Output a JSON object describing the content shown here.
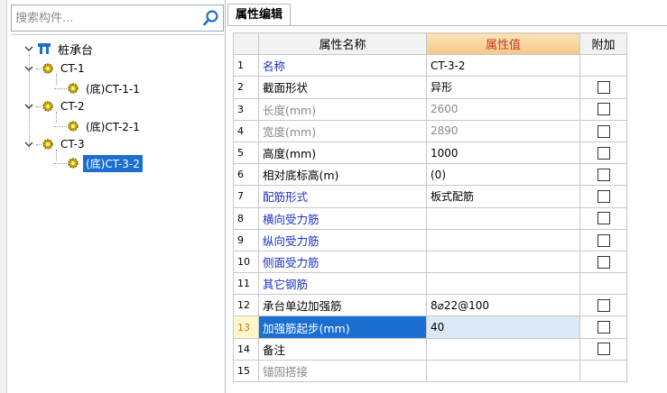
{
  "search": {
    "placeholder": "搜索构件..."
  },
  "tree": {
    "root": "桩承台",
    "groups": [
      {
        "label": "CT-1",
        "child": "(底)CT-1-1"
      },
      {
        "label": "CT-2",
        "child": "(底)CT-2-1"
      },
      {
        "label": "CT-3",
        "child": "(底)CT-3-2"
      }
    ],
    "selected": "(底)CT-3-2"
  },
  "tab": {
    "label": "属性编辑"
  },
  "grid": {
    "headers": {
      "name": "属性名称",
      "value": "属性值",
      "add": "附加"
    },
    "rows": [
      {
        "num": "1",
        "name": "名称",
        "value": "CT-3-2",
        "style": "blue",
        "checkbox": false
      },
      {
        "num": "2",
        "name": "截面形状",
        "value": "异形",
        "style": "normal",
        "checkbox": true
      },
      {
        "num": "3",
        "name": "长度(mm)",
        "value": "2600",
        "style": "gray",
        "checkbox": true
      },
      {
        "num": "4",
        "name": "宽度(mm)",
        "value": "2890",
        "style": "gray",
        "checkbox": true
      },
      {
        "num": "5",
        "name": "高度(mm)",
        "value": "1000",
        "style": "normal",
        "checkbox": true
      },
      {
        "num": "6",
        "name": "相对底标高(m)",
        "value": "(0)",
        "style": "normal",
        "checkbox": true
      },
      {
        "num": "7",
        "name": "配筋形式",
        "value": "板式配筋",
        "style": "blue",
        "checkbox": true
      },
      {
        "num": "8",
        "name": "横向受力筋",
        "value": "",
        "style": "blue",
        "checkbox": true
      },
      {
        "num": "9",
        "name": "纵向受力筋",
        "value": "",
        "style": "blue",
        "checkbox": true
      },
      {
        "num": "10",
        "name": "侧面受力筋",
        "value": "",
        "style": "blue",
        "checkbox": true
      },
      {
        "num": "11",
        "name": "其它钢筋",
        "value": "",
        "style": "blue",
        "checkbox": false
      },
      {
        "num": "12",
        "name": "承台单边加强筋",
        "value": "8⌀22@100",
        "style": "normal",
        "checkbox": true
      },
      {
        "num": "13",
        "name": "加强筋起步(mm)",
        "value": "40",
        "style": "selected",
        "checkbox": true
      },
      {
        "num": "14",
        "name": "备注",
        "value": "",
        "style": "normal",
        "checkbox": true
      },
      {
        "num": "15",
        "name": "锚固搭接",
        "value": "",
        "style": "gray-expand",
        "checkbox": false
      }
    ]
  },
  "colors": {
    "selection": "#1c6fd1",
    "link_text": "#1a2dc9",
    "value_header": "#f3c985"
  }
}
